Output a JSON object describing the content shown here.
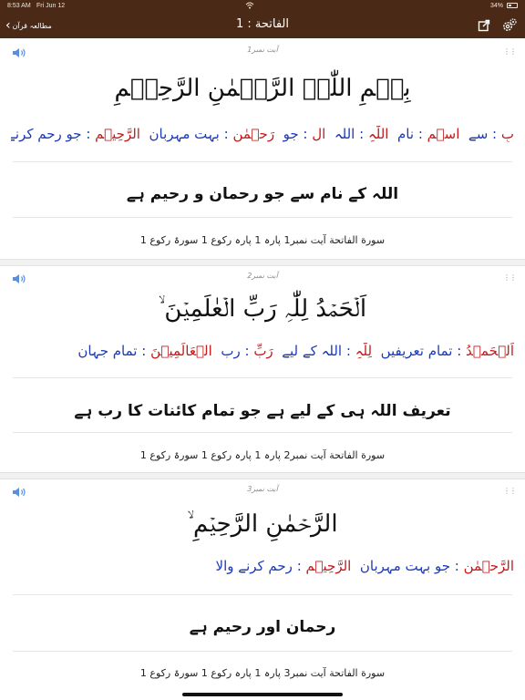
{
  "status_bar": {
    "time": "8:53 AM",
    "date": "Fri Jun 12",
    "battery": "34%"
  },
  "nav": {
    "back_label": "مطالعہ قرآن",
    "title": "الفاتحة : 1",
    "icons": {
      "back": "chevron-left-icon",
      "share": "share-icon",
      "settings": "gear-icon"
    }
  },
  "colors": {
    "nav_bg": "#4a2a17",
    "arabic_word": "#c21b1b",
    "urdu_meaning": "#1b3bb5"
  },
  "ayahs": [
    {
      "label": "آیت نمبر1",
      "arabic": "بِسۡمِ اللّٰہِ الرَّحۡمٰنِ الرَّحِیۡمِ",
      "words": [
        {
          "ar": "بِ",
          "ur": "سے"
        },
        {
          "ar": "اسۡمِ",
          "ur": "نام"
        },
        {
          "ar": "اللّٰہِ",
          "ur": "اللہ"
        },
        {
          "ar": "ال",
          "ur": "جو"
        },
        {
          "ar": "رَحۡمٰنِ",
          "ur": "بہت مہربان"
        },
        {
          "ar": "الرَّحِیۡمِ",
          "ur": "جو رحم کرنے والا"
        }
      ],
      "translation": "اللہ کے نام سے جو رحمان و رحیم ہے",
      "reference": "سورة الفاتحة آیت نمبر1  پارہ 1 پارہ رکوع 1 سورۃ رکوع 1"
    },
    {
      "label": "آیت نمبر2",
      "arabic": "اَلۡحَمۡدُ لِلّٰہِ رَبِّ الۡعٰلَمِیۡنَ ۙ",
      "words": [
        {
          "ar": "اَلۡحَمۡدُ",
          "ur": "تمام تعریفیں"
        },
        {
          "ar": "لِلّٰہِ",
          "ur": "اللہ کے لیے"
        },
        {
          "ar": "رَبِّ",
          "ur": "رب"
        },
        {
          "ar": "الۡعَالَمِیۡنَ",
          "ur": "تمام جہان"
        }
      ],
      "translation": "تعریف اللہ ہی کے لیے ہے جو تمام کائنات کا رب ہے",
      "reference": "سورة الفاتحة آیت نمبر2  پارہ 1 پارہ رکوع 1 سورۃ رکوع 1"
    },
    {
      "label": "آیت نمبر3",
      "arabic": "الرَّحۡمٰنِ الرَّحِیۡمِ ۙ",
      "words": [
        {
          "ar": "الرَّحۡمٰنِ",
          "ur": "جو بہت مہربان"
        },
        {
          "ar": "الرَّحِیۡمِ",
          "ur": "رحم کرنے والا"
        }
      ],
      "translation": "رحمان اور رحیم ہے",
      "reference": "سورة الفاتحة آیت نمبر3  پارہ 1 پارہ رکوع 1 سورۃ رکوع 1"
    }
  ]
}
